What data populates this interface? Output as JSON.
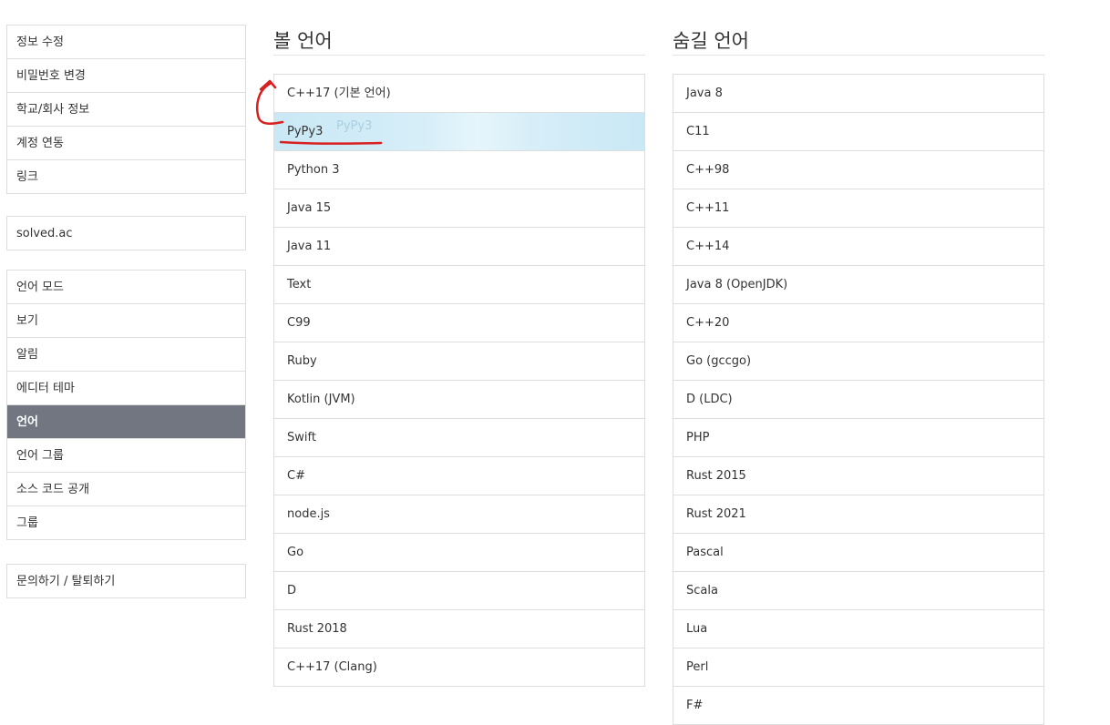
{
  "sidebar": {
    "group1": [
      "정보 수정",
      "비밀번호 변경",
      "학교/회사 정보",
      "계정 연동",
      "링크"
    ],
    "group2": [
      "solved.ac"
    ],
    "group3": [
      "언어 모드",
      "보기",
      "알림",
      "에디터 테마",
      "언어",
      "언어 그룹",
      "소스 코드 공개",
      "그룹"
    ],
    "group4": [
      "문의하기 / 탈퇴하기"
    ],
    "active": "언어"
  },
  "visible_langs": {
    "title": "볼 언어",
    "items": [
      "C++17 (기본 언어)",
      "PyPy3",
      "Python 3",
      "Java 15",
      "Java 11",
      "Text",
      "C99",
      "Ruby",
      "Kotlin (JVM)",
      "Swift",
      "C#",
      "node.js",
      "Go",
      "D",
      "Rust 2018",
      "C++17 (Clang)"
    ],
    "dragging_item": "PyPy3",
    "drag_ghost": "PyPy3"
  },
  "hidden_langs": {
    "title": "숨길 언어",
    "items": [
      "Java 8",
      "C11",
      "C++98",
      "C++11",
      "C++14",
      "Java 8 (OpenJDK)",
      "C++20",
      "Go (gccgo)",
      "D (LDC)",
      "PHP",
      "Rust 2015",
      "Rust 2021",
      "Pascal",
      "Scala",
      "Lua",
      "Perl",
      "F#"
    ]
  },
  "colors": {
    "active_bg": "#717680",
    "drag_highlight": "#d6eef8",
    "annotation": "#d92020",
    "border": "#dddddd"
  }
}
